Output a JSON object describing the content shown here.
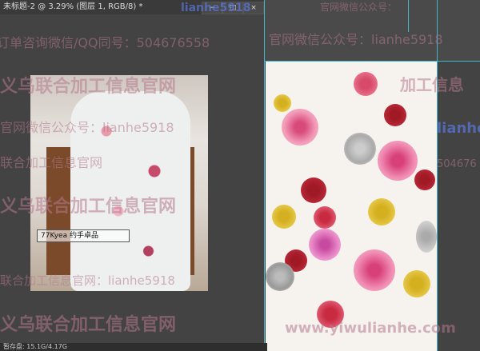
{
  "window": {
    "title": "未标题-2 @ 3.29% (图层 1, RGB/8) *",
    "close_label": "×"
  },
  "window_buttons": [
    "−",
    "□",
    "×"
  ],
  "status": {
    "zoom": "",
    "doc_label": "暂存盘: 15.1G/4.17G"
  },
  "image_tag": {
    "text": "77Kyea 约手卓品"
  },
  "watermarks": [
    {
      "text": "订单咨询微信/QQ同号：504676558"
    },
    {
      "text": "官网微信公众号：lianhe5918"
    },
    {
      "text": "义乌联合加工信息官网"
    },
    {
      "text": "官网微信公众号：lianhe5918"
    },
    {
      "text": "联合加工信息官网"
    },
    {
      "text": "义乌联合加工信息官网"
    },
    {
      "text": "联合加工信息官网：lianhe5918"
    },
    {
      "text": "义乌联合加工信息官网"
    },
    {
      "text": "www.yiwulianhe.com"
    },
    {
      "text": "lianhe5918"
    },
    {
      "text": "官网微信公众号："
    },
    {
      "text": "加工信息"
    },
    {
      "text": "504676"
    },
    {
      "text": "lianhe"
    }
  ],
  "colors": {
    "workspace": "#434343",
    "guide": "#3fb7c9",
    "watermark": "#b47890"
  }
}
